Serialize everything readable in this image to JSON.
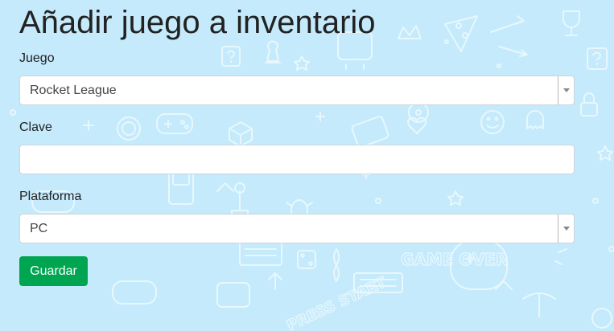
{
  "page": {
    "title": "Añadir juego a inventario"
  },
  "form": {
    "juego": {
      "label": "Juego",
      "selected": "Rocket League"
    },
    "clave": {
      "label": "Clave",
      "value": "",
      "placeholder": ""
    },
    "plataforma": {
      "label": "Plataforma",
      "selected": "PC"
    },
    "submit_label": "Guardar"
  },
  "background": {
    "pattern": "gaming-doodles",
    "pattern_text": [
      "GAME OVER",
      "PRESS START"
    ]
  },
  "colors": {
    "background": "#c4eafb",
    "pattern_stroke": "#eaf8ff",
    "button": "#00a551"
  }
}
